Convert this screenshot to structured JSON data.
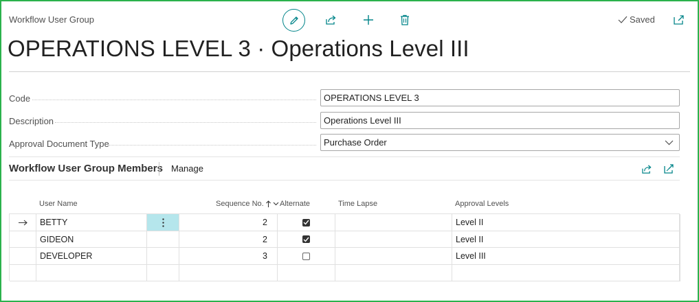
{
  "header": {
    "context_title": "Workflow User Group",
    "saved_label": "Saved",
    "page_title": "OPERATIONS LEVEL 3 · Operations Level III"
  },
  "toolbar": {
    "icons": [
      "edit-icon",
      "share-icon",
      "plus-icon",
      "delete-icon",
      "open-new-window-icon"
    ]
  },
  "fields": {
    "code": {
      "label": "Code",
      "value": "OPERATIONS LEVEL 3"
    },
    "description": {
      "label": "Description",
      "value": "Operations Level III"
    },
    "approval_document_type": {
      "label": "Approval Document Type",
      "value": "Purchase Order"
    }
  },
  "members": {
    "title": "Workflow User Group Members",
    "manage_label": "Manage",
    "columns": {
      "user_name": "User Name",
      "sequence_no": "Sequence No.",
      "alternate": "Alternate",
      "time_lapse": "Time Lapse",
      "approval_levels": "Approval Levels"
    },
    "sort": "ascending",
    "rows": [
      {
        "user_name": "BETTY",
        "sequence_no": "2",
        "alternate": true,
        "time_lapse": "",
        "approval_levels": "Level II",
        "selected": true
      },
      {
        "user_name": "GIDEON",
        "sequence_no": "2",
        "alternate": true,
        "time_lapse": "",
        "approval_levels": "Level II",
        "selected": false
      },
      {
        "user_name": "DEVELOPER",
        "sequence_no": "3",
        "alternate": false,
        "time_lapse": "",
        "approval_levels": "Level III",
        "selected": false
      },
      {
        "user_name": "",
        "sequence_no": "",
        "alternate": null,
        "time_lapse": "",
        "approval_levels": "",
        "selected": false
      }
    ]
  },
  "colors": {
    "accent": "#008489",
    "border_frame": "#2bb24c",
    "selected_cell": "#b5e6ec"
  }
}
